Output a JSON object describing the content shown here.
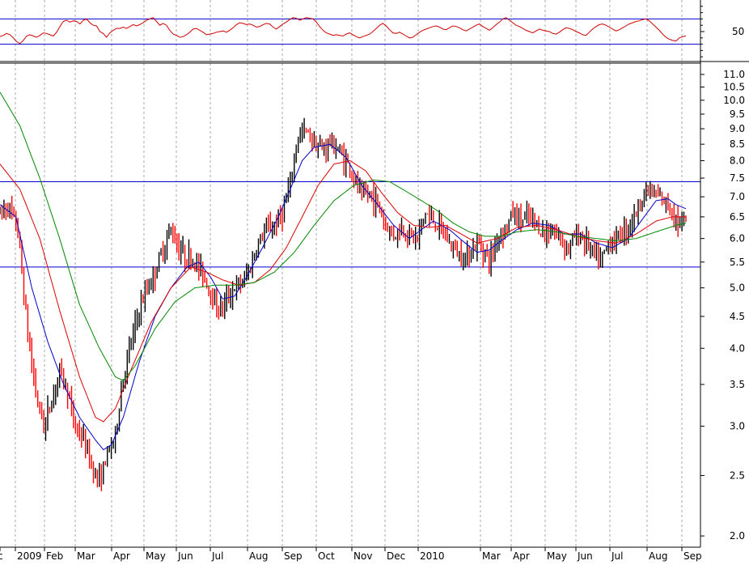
{
  "chart_data": [
    {
      "type": "line",
      "panel": "oscillator",
      "ylim": [
        0,
        100
      ],
      "tick_labels": [
        "50"
      ],
      "reference_lines": [
        70,
        30
      ],
      "series": [
        {
          "color": "#d00000",
          "values": [
            42,
            44,
            47,
            45,
            40,
            34,
            31,
            36,
            43,
            45,
            43,
            41,
            44,
            48,
            47,
            45,
            43,
            49,
            58,
            66,
            68,
            65,
            67,
            66,
            62,
            68,
            70,
            64,
            60,
            59,
            50,
            47,
            41,
            48,
            52,
            55,
            55,
            57,
            55,
            58,
            61,
            59,
            61,
            64,
            68,
            70,
            72,
            66,
            60,
            63,
            60,
            52,
            46,
            44,
            41,
            42,
            45,
            49,
            54,
            55,
            52,
            49,
            45,
            46,
            47,
            49,
            50,
            51,
            49,
            52,
            56,
            61,
            64,
            63,
            61,
            62,
            60,
            57,
            58,
            61,
            63,
            62,
            57,
            54,
            58,
            62,
            65,
            69,
            72,
            71,
            68,
            70,
            72,
            71,
            70,
            65,
            58,
            52,
            48,
            46,
            44,
            45,
            44,
            43,
            46,
            48,
            45,
            42,
            40,
            42,
            44,
            46,
            50,
            55,
            60,
            63,
            59,
            53,
            48,
            47,
            49,
            46,
            43,
            40,
            41,
            45,
            49,
            52,
            54,
            56,
            58,
            59,
            57,
            54,
            53,
            56,
            59,
            58,
            56,
            53,
            51,
            54,
            57,
            60,
            62,
            58,
            55,
            52,
            56,
            61,
            65,
            70,
            72,
            68,
            64,
            60,
            58,
            55,
            52,
            50,
            48,
            51,
            54,
            52,
            51,
            50,
            47,
            46,
            49,
            53,
            56,
            55,
            53,
            50,
            48,
            45,
            44,
            49,
            54,
            58,
            61,
            62,
            60,
            57,
            54,
            51,
            53,
            56,
            59,
            62,
            64,
            66,
            67,
            69,
            70,
            67,
            62,
            57,
            52,
            46,
            41,
            38,
            36,
            35,
            40,
            42,
            43
          ]
        }
      ]
    },
    {
      "type": "line",
      "panel": "price",
      "scale": "log",
      "x_tick_labels": [
        "c",
        "2009",
        "Feb",
        "Mar",
        "Apr",
        "May",
        "Jun",
        "Jul",
        "Aug",
        "Sep",
        "Oct",
        "Nov",
        "Dec",
        "2010",
        "Mar",
        "Apr",
        "May",
        "Jun",
        "Jul",
        "Aug",
        "Sep"
      ],
      "y_tick_labels": [
        "11.0",
        "10.5",
        "10.0",
        "9.5",
        "9.0",
        "8.5",
        "8.0",
        "7.5",
        "7.0",
        "6.5",
        "6.0",
        "5.5",
        "5.0",
        "4.5",
        "4.0",
        "3.5",
        "3.0",
        "2.5",
        "2.0"
      ],
      "ylim": [
        1.93,
        11.4
      ],
      "reference_lines": [
        7.4,
        5.4
      ],
      "price_bars": {
        "up_color": "#000000",
        "down_color": "#ff0000",
        "anchors": [
          [
            0,
            6.6
          ],
          [
            4,
            6.8
          ],
          [
            9,
            6.2
          ],
          [
            14,
            4.2
          ],
          [
            18,
            3.4
          ],
          [
            22,
            3.0
          ],
          [
            26,
            3.3
          ],
          [
            30,
            3.7
          ],
          [
            34,
            3.4
          ],
          [
            38,
            3.0
          ],
          [
            42,
            2.85
          ],
          [
            46,
            2.6
          ],
          [
            50,
            2.45
          ],
          [
            54,
            2.7
          ],
          [
            58,
            2.9
          ],
          [
            62,
            3.6
          ],
          [
            66,
            4.1
          ],
          [
            70,
            4.6
          ],
          [
            74,
            5.0
          ],
          [
            78,
            5.3
          ],
          [
            82,
            5.8
          ],
          [
            86,
            6.2
          ],
          [
            90,
            5.8
          ],
          [
            94,
            5.6
          ],
          [
            98,
            5.5
          ],
          [
            102,
            5.3
          ],
          [
            106,
            4.9
          ],
          [
            110,
            4.6
          ],
          [
            114,
            4.8
          ],
          [
            118,
            5.0
          ],
          [
            122,
            5.1
          ],
          [
            126,
            5.4
          ],
          [
            130,
            5.9
          ],
          [
            134,
            6.2
          ],
          [
            138,
            6.3
          ],
          [
            142,
            6.6
          ],
          [
            146,
            7.3
          ],
          [
            150,
            8.8
          ],
          [
            154,
            8.9
          ],
          [
            158,
            8.6
          ],
          [
            162,
            8.3
          ],
          [
            166,
            8.6
          ],
          [
            170,
            8.3
          ],
          [
            174,
            8.0
          ],
          [
            178,
            7.5
          ],
          [
            182,
            7.0
          ],
          [
            186,
            7.1
          ],
          [
            190,
            6.8
          ],
          [
            194,
            6.3
          ],
          [
            198,
            6.1
          ],
          [
            202,
            6.2
          ],
          [
            206,
            6.1
          ],
          [
            210,
            6.0
          ],
          [
            214,
            6.6
          ],
          [
            218,
            6.4
          ],
          [
            222,
            6.2
          ],
          [
            226,
            5.9
          ],
          [
            230,
            5.7
          ],
          [
            234,
            5.6
          ],
          [
            238,
            5.8
          ],
          [
            242,
            5.9
          ],
          [
            246,
            5.5
          ],
          [
            250,
            6.0
          ],
          [
            254,
            6.2
          ],
          [
            258,
            6.6
          ],
          [
            262,
            6.4
          ],
          [
            266,
            6.5
          ],
          [
            270,
            6.3
          ],
          [
            274,
            6.1
          ],
          [
            278,
            6.2
          ],
          [
            282,
            6.0
          ],
          [
            286,
            5.8
          ],
          [
            290,
            6.1
          ],
          [
            294,
            6.0
          ],
          [
            298,
            5.7
          ],
          [
            302,
            5.5
          ],
          [
            306,
            5.9
          ],
          [
            310,
            6.0
          ],
          [
            314,
            6.2
          ],
          [
            318,
            6.4
          ],
          [
            322,
            6.9
          ],
          [
            326,
            7.2
          ],
          [
            330,
            7.0
          ],
          [
            334,
            6.9
          ],
          [
            338,
            6.7
          ],
          [
            342,
            6.3
          ],
          [
            345,
            6.4
          ]
        ]
      },
      "series": [
        {
          "color": "#0000cc",
          "values": [
            [
              0,
              6.8
            ],
            [
              8,
              6.5
            ],
            [
              16,
              5.0
            ],
            [
              24,
              4.1
            ],
            [
              32,
              3.5
            ],
            [
              40,
              3.1
            ],
            [
              48,
              2.85
            ],
            [
              52,
              2.75
            ],
            [
              56,
              2.8
            ],
            [
              62,
              3.1
            ],
            [
              70,
              3.8
            ],
            [
              78,
              4.5
            ],
            [
              86,
              5.0
            ],
            [
              94,
              5.4
            ],
            [
              100,
              5.5
            ],
            [
              106,
              5.2
            ],
            [
              112,
              4.8
            ],
            [
              118,
              4.85
            ],
            [
              124,
              5.2
            ],
            [
              132,
              5.8
            ],
            [
              140,
              6.5
            ],
            [
              146,
              7.2
            ],
            [
              152,
              8.0
            ],
            [
              158,
              8.4
            ],
            [
              166,
              8.5
            ],
            [
              174,
              8.1
            ],
            [
              182,
              7.3
            ],
            [
              190,
              6.8
            ],
            [
              198,
              6.3
            ],
            [
              206,
              6.0
            ],
            [
              212,
              6.2
            ],
            [
              218,
              6.4
            ],
            [
              226,
              6.2
            ],
            [
              234,
              5.9
            ],
            [
              240,
              5.7
            ],
            [
              246,
              5.75
            ],
            [
              252,
              5.95
            ],
            [
              260,
              6.2
            ],
            [
              268,
              6.35
            ],
            [
              276,
              6.3
            ],
            [
              284,
              6.1
            ],
            [
              292,
              6.1
            ],
            [
              300,
              5.9
            ],
            [
              308,
              5.8
            ],
            [
              316,
              6.0
            ],
            [
              324,
              6.5
            ],
            [
              330,
              6.9
            ],
            [
              336,
              6.95
            ],
            [
              340,
              6.8
            ],
            [
              345,
              6.7
            ]
          ]
        },
        {
          "color": "#dd0000",
          "values": [
            [
              0,
              7.9
            ],
            [
              10,
              7.2
            ],
            [
              20,
              6.0
            ],
            [
              30,
              4.6
            ],
            [
              40,
              3.6
            ],
            [
              48,
              3.1
            ],
            [
              52,
              3.05
            ],
            [
              58,
              3.2
            ],
            [
              66,
              3.7
            ],
            [
              76,
              4.4
            ],
            [
              86,
              5.0
            ],
            [
              96,
              5.4
            ],
            [
              104,
              5.3
            ],
            [
              112,
              5.15
            ],
            [
              120,
              5.05
            ],
            [
              128,
              5.1
            ],
            [
              136,
              5.35
            ],
            [
              144,
              5.8
            ],
            [
              152,
              6.5
            ],
            [
              160,
              7.3
            ],
            [
              168,
              7.9
            ],
            [
              176,
              8.0
            ],
            [
              184,
              7.7
            ],
            [
              192,
              7.1
            ],
            [
              200,
              6.6
            ],
            [
              208,
              6.3
            ],
            [
              216,
              6.25
            ],
            [
              224,
              6.3
            ],
            [
              232,
              6.1
            ],
            [
              240,
              5.9
            ],
            [
              250,
              6.0
            ],
            [
              260,
              6.25
            ],
            [
              270,
              6.3
            ],
            [
              280,
              6.2
            ],
            [
              290,
              6.05
            ],
            [
              300,
              5.95
            ],
            [
              310,
              5.9
            ],
            [
              320,
              6.1
            ],
            [
              330,
              6.4
            ],
            [
              338,
              6.5
            ],
            [
              345,
              6.5
            ]
          ]
        },
        {
          "color": "#008800",
          "values": [
            [
              0,
              10.3
            ],
            [
              10,
              9.1
            ],
            [
              20,
              7.5
            ],
            [
              30,
              6.0
            ],
            [
              40,
              4.7
            ],
            [
              50,
              4.0
            ],
            [
              58,
              3.6
            ],
            [
              62,
              3.55
            ],
            [
              68,
              3.75
            ],
            [
              78,
              4.3
            ],
            [
              88,
              4.75
            ],
            [
              98,
              5.0
            ],
            [
              108,
              5.05
            ],
            [
              118,
              5.05
            ],
            [
              128,
              5.1
            ],
            [
              138,
              5.3
            ],
            [
              148,
              5.7
            ],
            [
              158,
              6.3
            ],
            [
              168,
              6.9
            ],
            [
              178,
              7.3
            ],
            [
              188,
              7.45
            ],
            [
              196,
              7.4
            ],
            [
              204,
              7.15
            ],
            [
              212,
              6.9
            ],
            [
              220,
              6.65
            ],
            [
              228,
              6.35
            ],
            [
              236,
              6.15
            ],
            [
              244,
              6.05
            ],
            [
              252,
              6.05
            ],
            [
              260,
              6.15
            ],
            [
              270,
              6.2
            ],
            [
              280,
              6.15
            ],
            [
              290,
              6.05
            ],
            [
              300,
              6.0
            ],
            [
              310,
              5.95
            ],
            [
              320,
              6.0
            ],
            [
              330,
              6.15
            ],
            [
              340,
              6.3
            ],
            [
              345,
              6.35
            ]
          ]
        }
      ]
    }
  ]
}
